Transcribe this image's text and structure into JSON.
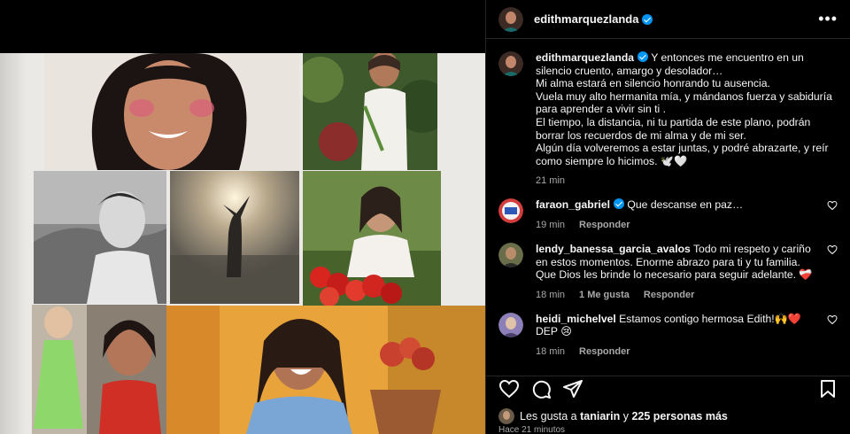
{
  "post": {
    "author": "edithmarquezlanda"
  },
  "caption": {
    "author": "edithmarquezlanda",
    "lines": [
      "Y entonces me encuentro en un",
      "silencio cruento, amargo y desolador…",
      "Mi alma estará en silencio honrando tu ausencia.",
      "Vuela muy alto hermanita mía, y mándanos fuerza y sabiduría",
      "para aprender a vivir sin ti .",
      "El tiempo, la distancia, ni tu partida de este plano, podrán",
      "borrar los recuerdos de mi alma y de mi ser.",
      "Algún día volveremos a estar juntas, y podré abrazarte, y reír",
      "como siempre lo hicimos. 🕊️🤍"
    ],
    "time": "21 min"
  },
  "comments": [
    {
      "author": "faraon_gabriel",
      "verified": true,
      "text": "Que descanse en paz…",
      "time": "19 min",
      "likes": "",
      "reply": "Responder"
    },
    {
      "author": "lendy_banessa_garcia_avalos",
      "verified": false,
      "text": "Todo mi respeto y cariño en estos momentos. Enorme abrazo para ti y tu familia. Que Dios les brinde lo necesario para seguir adelante. ❤️‍🩹",
      "time": "18 min",
      "likes": "1 Me gusta",
      "reply": "Responder"
    },
    {
      "author": "heidi_michelvel",
      "verified": false,
      "text": "Estamos contigo hermosa Edith!🙌❤️DEP 😢",
      "time": "18 min",
      "likes": "",
      "reply": "Responder"
    }
  ],
  "likes": {
    "prefix": "Les gusta a ",
    "user": "taniarin",
    "middle": " y ",
    "count": "225 personas más"
  },
  "posted_ago": "Hace 21 minutos",
  "colors": {
    "background": "#000000",
    "text": "#f5f5f5",
    "secondary": "#a8a8a8",
    "verified": "#0095f6",
    "divider": "#262626"
  },
  "icons": [
    "more-icon",
    "heart-icon",
    "comment-icon",
    "share-icon",
    "save-icon",
    "verified-icon"
  ]
}
